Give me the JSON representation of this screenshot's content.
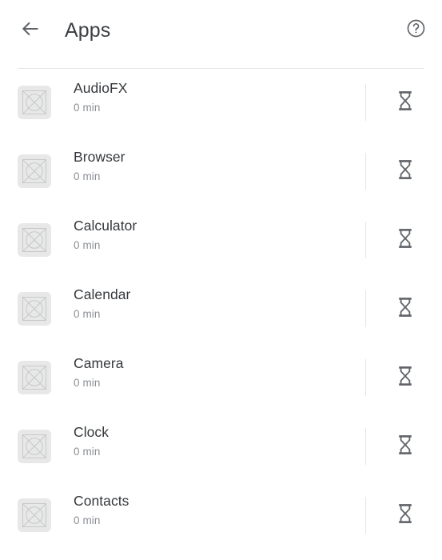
{
  "header": {
    "title": "Apps",
    "back_icon": "arrow-left-icon",
    "help_icon": "help-circle-icon"
  },
  "colors": {
    "background": "#ffffff",
    "title_text": "#3c4043",
    "app_name_text": "#35383c",
    "usage_text": "#8b8f94",
    "divider": "#e3e5e8",
    "icon_placeholder_bg": "#e8e8e8",
    "icon_placeholder_stroke": "#c6c8c9",
    "header_icon": "#5f6368",
    "timer_icon": "#5f6368"
  },
  "list": {
    "row_icon": "app-placeholder-icon",
    "row_action_icon": "hourglass-icon",
    "items": [
      {
        "name": "AudioFX",
        "usage": "0 min"
      },
      {
        "name": "Browser",
        "usage": "0 min"
      },
      {
        "name": "Calculator",
        "usage": "0 min"
      },
      {
        "name": "Calendar",
        "usage": "0 min"
      },
      {
        "name": "Camera",
        "usage": "0 min"
      },
      {
        "name": "Clock",
        "usage": "0 min"
      },
      {
        "name": "Contacts",
        "usage": "0 min"
      }
    ]
  }
}
